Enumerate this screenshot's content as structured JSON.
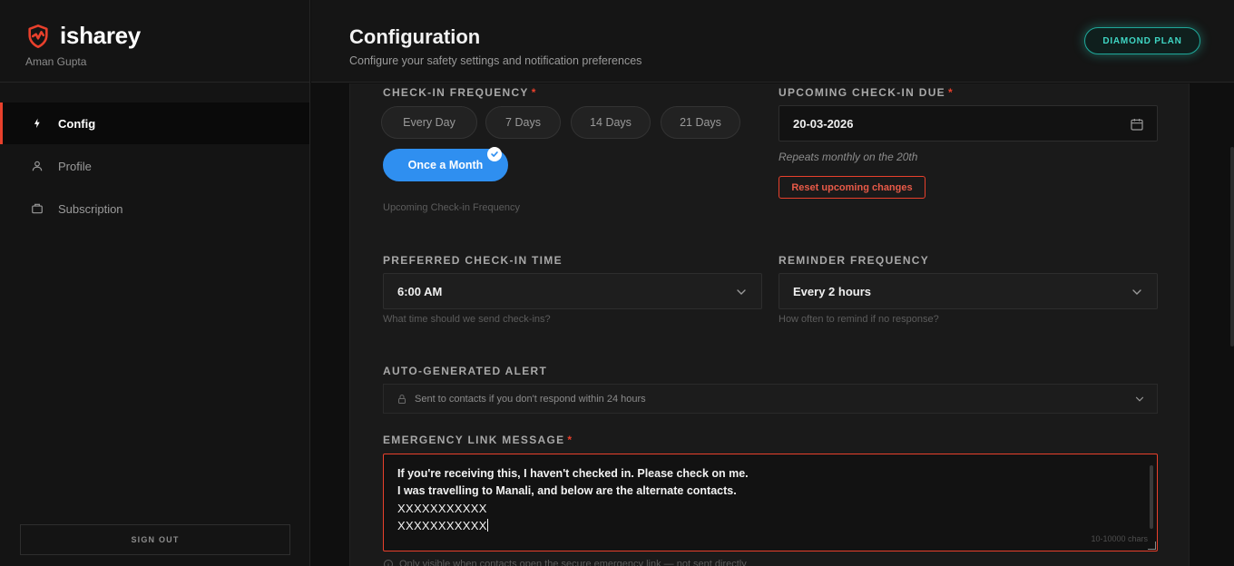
{
  "brand": {
    "name": "isharey",
    "user": "Aman Gupta",
    "accent": "#e8402c"
  },
  "nav": {
    "items": [
      {
        "label": "Config",
        "icon": "lightning-icon",
        "active": true
      },
      {
        "label": "Profile",
        "icon": "user-icon",
        "active": false
      },
      {
        "label": "Subscription",
        "icon": "briefcase-icon",
        "active": false
      }
    ],
    "signout": "SIGN OUT"
  },
  "header": {
    "title": "Configuration",
    "subtitle": "Configure your safety settings and notification preferences",
    "plan": "DIAMOND PLAN"
  },
  "checkin_frequency": {
    "label": "CHECK-IN FREQUENCY",
    "required": "*",
    "options": [
      "Every Day",
      "7 Days",
      "14 Days",
      "21 Days",
      "Once a Month"
    ],
    "selected": "Once a Month",
    "hint": "Upcoming Check-in Frequency"
  },
  "upcoming_due": {
    "label": "UPCOMING CHECK-IN DUE",
    "required": "*",
    "value": "20-03-2026",
    "note": "Repeats monthly on the 20th",
    "reset_label": "Reset upcoming changes"
  },
  "preferred_time": {
    "label": "PREFERRED CHECK-IN TIME",
    "value": "6:00 AM",
    "hint": "What time should we send check-ins?"
  },
  "reminder_frequency": {
    "label": "REMINDER FREQUENCY",
    "value": "Every 2 hours",
    "hint": "How often to remind if no response?"
  },
  "auto_alert": {
    "label": "AUTO-GENERATED ALERT",
    "text": "Sent to contacts if you don't respond within 24 hours"
  },
  "emergency_message": {
    "label": "EMERGENCY LINK MESSAGE",
    "required": "*",
    "lines": [
      "If you're receiving this, I haven't checked in. Please check on me.",
      "I was travelling to Manali, and below are the alternate contacts.",
      "XXXXXXXXXXX",
      "XXXXXXXXXXX"
    ],
    "char_hint": "10-10000 chars",
    "footnote": "Only visible when contacts open the secure emergency link — not sent directly"
  }
}
